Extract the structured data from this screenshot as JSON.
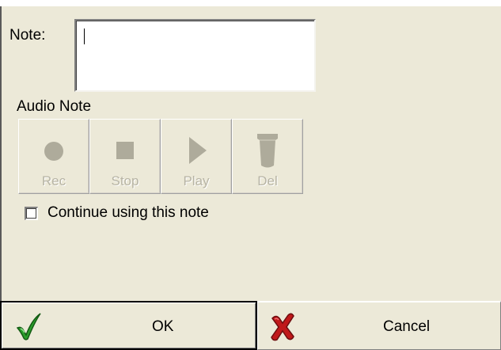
{
  "note": {
    "label": "Note:",
    "value": ""
  },
  "audio": {
    "label": "Audio Note",
    "buttons": [
      {
        "label": "Rec",
        "icon": "record-icon"
      },
      {
        "label": "Stop",
        "icon": "stop-icon"
      },
      {
        "label": "Play",
        "icon": "play-icon"
      },
      {
        "label": "Del",
        "icon": "trash-icon"
      }
    ]
  },
  "continue": {
    "label": "Continue using this note",
    "checked": false
  },
  "actions": {
    "ok": {
      "label": "OK",
      "icon": "checkmark-icon",
      "color": "#2a9d2a"
    },
    "cancel": {
      "label": "Cancel",
      "icon": "red-x-icon",
      "color": "#c0181a"
    }
  },
  "colors": {
    "background": "#ece9d8",
    "disabled": "#aeab9b"
  }
}
